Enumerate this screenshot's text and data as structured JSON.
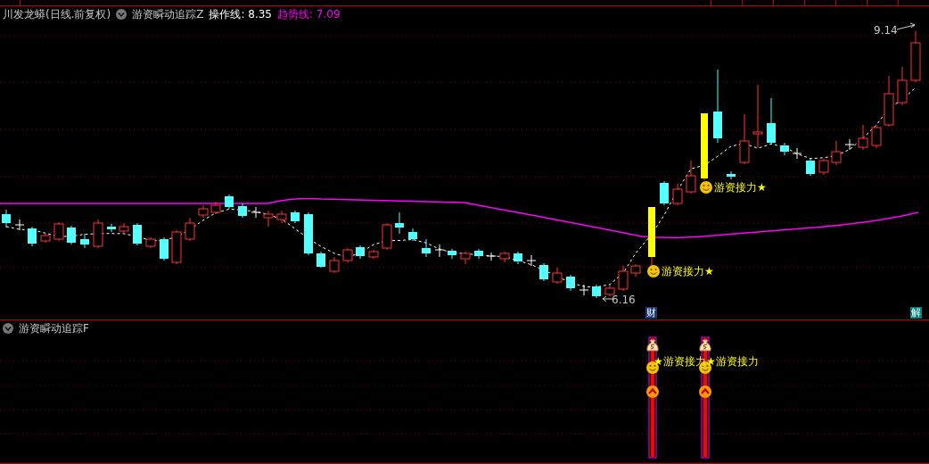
{
  "header": {
    "stock": "川发龙蟒(日线.前复权)",
    "indicator": "游资瞬动追踪Z",
    "lines": [
      {
        "label": "操作线: 8.35",
        "color": "#ffffff"
      },
      {
        "label": "趋势线: 7.09",
        "color": "#ff00ff"
      }
    ]
  },
  "price_labels": [
    {
      "kind": "high",
      "text": "9.14"
    },
    {
      "kind": "low",
      "text": "6.16"
    }
  ],
  "signals": [
    {
      "text": "游资接力★"
    },
    {
      "text": "游资接力★"
    }
  ],
  "badges": [
    {
      "kind": "finance",
      "text": "财"
    },
    {
      "kind": "unlock",
      "text": "解"
    }
  ],
  "lower_panel": {
    "title": "游资瞬动追踪F",
    "signals": [
      {
        "text": "★游资接力"
      },
      {
        "text": "★游资接力"
      }
    ]
  }
}
